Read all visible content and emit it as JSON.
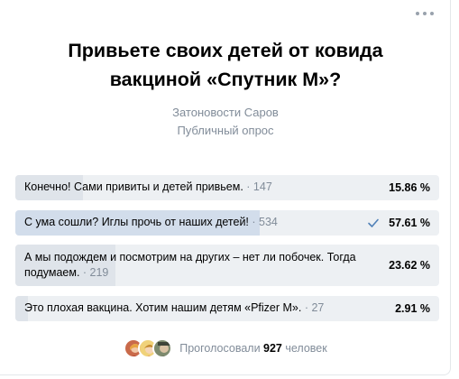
{
  "poll": {
    "title_line1": "Привьете своих детей от ковида",
    "title_line2": "вакциной «Спутник М»?",
    "author": "Затоновости Саров",
    "type": "Публичный опрос",
    "options": [
      {
        "text": "Конечно! Сами привиты и детей привьем.",
        "count_text": " · 147",
        "percent_label": "15.86 %",
        "percent": 15.86,
        "voted": false
      },
      {
        "text": "С ума сошли? Иглы прочь от наших детей!",
        "count_text": " · 534",
        "percent_label": "57.61 %",
        "percent": 57.61,
        "voted": true
      },
      {
        "text": "А мы подождем и посмотрим на других – нет ли побочек. Тогда подумаем.",
        "count_text": " · 219",
        "percent_label": "23.62 %",
        "percent": 23.62,
        "voted": false
      },
      {
        "text": "Это плохая вакцина. Хотим нашим детям «Pfizer M».",
        "count_text": " · 27",
        "percent_label": "2.91 %",
        "percent": 2.91,
        "voted": false
      }
    ],
    "footer_prefix": "Проголосовали ",
    "footer_count": "927",
    "footer_suffix": " человек"
  },
  "icons": {
    "more": "more-horizontal-icon",
    "check": "check-icon"
  },
  "colors": {
    "option_bg": "#edf0f3",
    "option_fill": "#dfe4ea",
    "option_fill_voted": "#d2ddeb",
    "secondary_text": "#818c99",
    "check": "#5181b8"
  }
}
